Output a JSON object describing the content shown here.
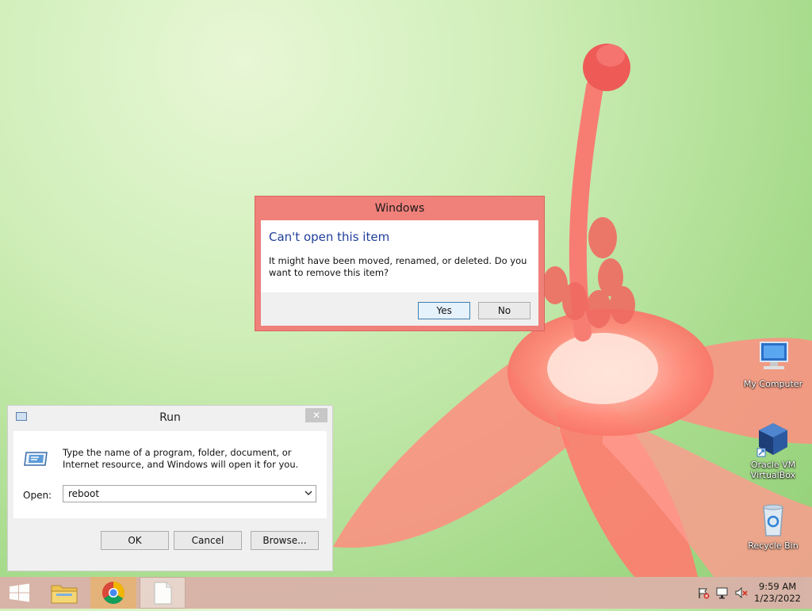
{
  "desktop": {
    "icons": [
      {
        "label": "My Computer",
        "icon": "computer-icon"
      },
      {
        "label": "Oracle VM VirtualBox",
        "icon": "virtualbox-icon"
      },
      {
        "label": "Recycle Bin",
        "icon": "recycle-bin-icon"
      }
    ]
  },
  "error_dialog": {
    "title": "Windows",
    "main_instruction": "Can't open this item",
    "message": "It might have been moved, renamed, or deleted. Do you want to remove this item?",
    "yes_label": "Yes",
    "no_label": "No",
    "accent_color": "#f0807a"
  },
  "run_dialog": {
    "title": "Run",
    "close_glyph": "✕",
    "description": "Type the name of a program, folder, document, or Internet resource, and Windows will open it for you.",
    "open_label": "Open:",
    "open_value": "reboot",
    "ok_label": "OK",
    "cancel_label": "Cancel",
    "browse_label": "Browse..."
  },
  "taskbar": {
    "items": [
      "start-button",
      "file-explorer-icon",
      "chrome-icon",
      "blank-document-icon"
    ],
    "tray_icons": [
      "action-center-flag-icon",
      "network-icon",
      "volume-muted-icon"
    ],
    "time": "9:59 AM",
    "date": "1/23/2022",
    "color": "#d9b3a8"
  }
}
